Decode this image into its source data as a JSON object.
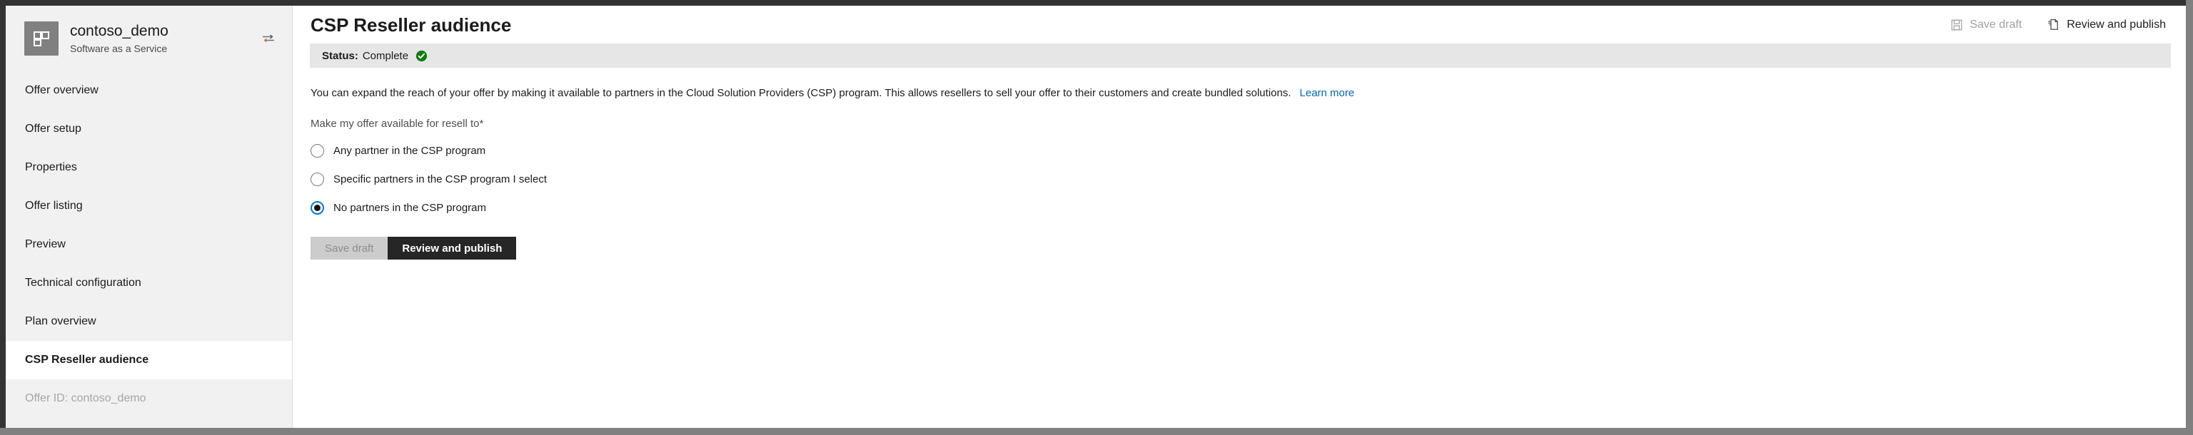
{
  "offer": {
    "name": "contoso_demo",
    "type": "Software as a Service",
    "logo_icon": "tiles-grid-icon",
    "switch_icon": "switch-offer-icon"
  },
  "sidebar": {
    "items": [
      {
        "label": "Offer overview",
        "active": false,
        "muted": false
      },
      {
        "label": "Offer setup",
        "active": false,
        "muted": false
      },
      {
        "label": "Properties",
        "active": false,
        "muted": false
      },
      {
        "label": "Offer listing",
        "active": false,
        "muted": false
      },
      {
        "label": "Preview",
        "active": false,
        "muted": false
      },
      {
        "label": "Technical configuration",
        "active": false,
        "muted": false
      },
      {
        "label": "Plan overview",
        "active": false,
        "muted": false
      },
      {
        "label": "CSP Reseller audience",
        "active": true,
        "muted": false
      },
      {
        "label": "Offer ID: contoso_demo",
        "active": false,
        "muted": true
      }
    ]
  },
  "header": {
    "title": "CSP Reseller audience",
    "save_draft_label": "Save draft",
    "save_draft_icon": "save-floppy-icon",
    "review_publish_label": "Review and publish",
    "review_publish_icon": "document-page-icon"
  },
  "status": {
    "label": "Status:",
    "value": "Complete",
    "icon": "green-check-circle-icon",
    "color": "#107c10"
  },
  "main": {
    "description": "You can expand the reach of your offer by making it available to partners in the Cloud Solution Providers (CSP) program. This allows resellers to sell your offer to their customers and create bundled solutions.",
    "learn_more_label": "Learn more",
    "field_label": "Make my offer available for resell to",
    "required_marker": "*",
    "radio_options": [
      {
        "label": "Any partner in the CSP program",
        "selected": false
      },
      {
        "label": "Specific partners in the CSP program I select",
        "selected": false
      },
      {
        "label": "No partners in the CSP program",
        "selected": true
      }
    ],
    "save_draft_label": "Save draft",
    "review_publish_label": "Review and publish"
  },
  "colors": {
    "accent": "#0067b8",
    "radio_selected": "#0078d4",
    "success": "#107c10",
    "primary_button_bg": "#262626"
  }
}
